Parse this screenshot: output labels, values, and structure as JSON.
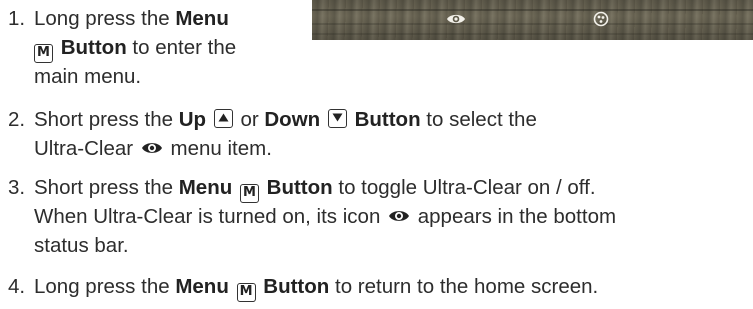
{
  "steps": [
    {
      "number": "1.",
      "line1_pre": "Long press the ",
      "line1_bold": "Menu",
      "line2_key": "M",
      "line2_bold": "Button",
      "line2_post": " to enter the",
      "line3": "main menu."
    },
    {
      "number": "2.",
      "line1_pre": "Short press the ",
      "up_bold": "Up",
      "or_text": " or ",
      "down_bold": "Down",
      "button_bold": "Button",
      "line1_post": " to select the",
      "line2_pre": "Ultra-Clear ",
      "line2_post": " menu item."
    },
    {
      "number": "3.",
      "line1_pre": "Short press the ",
      "menu_bold": "Menu",
      "key": "M",
      "button_bold": "Button",
      "line1_post": " to toggle Ultra-Clear on / off.",
      "line2_pre": "When Ultra-Clear is turned on, its icon ",
      "line2_post": " appears in the bottom",
      "line3": "status bar."
    },
    {
      "number": "4.",
      "line1_pre": "Long press the ",
      "menu_bold": "Menu",
      "key": "M",
      "button_bold": "Button",
      "line1_post": " to return to the home screen."
    }
  ],
  "screen": {
    "icons": [
      "eye-icon",
      "shutter-icon"
    ]
  }
}
